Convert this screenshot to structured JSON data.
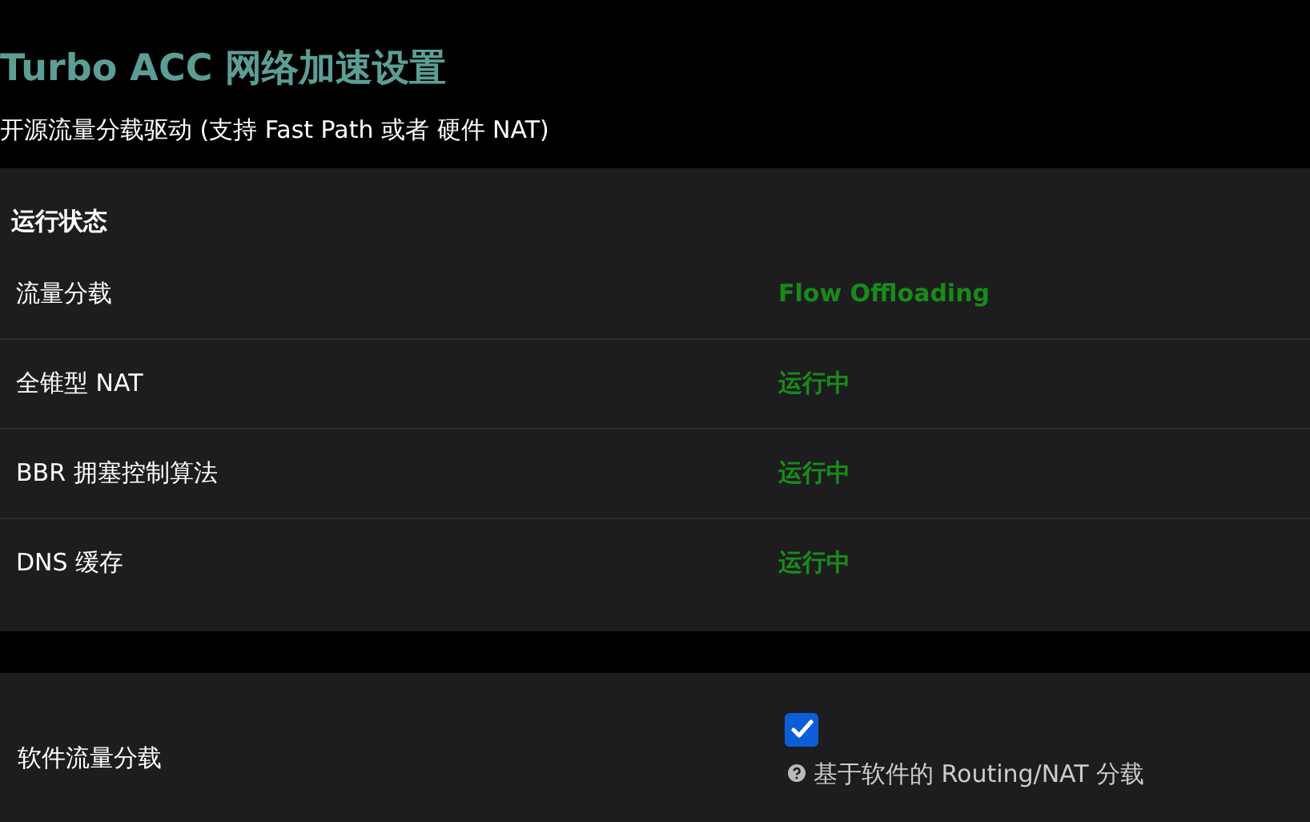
{
  "page": {
    "title": "Turbo ACC 网络加速设置",
    "subtitle": "开源流量分载驱动 (支持 Fast Path 或者 硬件 NAT)"
  },
  "status": {
    "title": "运行状态",
    "rows": [
      {
        "label": "流量分载",
        "value": "Flow Offloading"
      },
      {
        "label": "全锥型 NAT",
        "value": "运行中"
      },
      {
        "label": "BBR 拥塞控制算法",
        "value": "运行中"
      },
      {
        "label": "DNS 缓存",
        "value": "运行中"
      }
    ]
  },
  "settings": [
    {
      "label": "软件流量分载",
      "checked": true,
      "help": "基于软件的 Routing/NAT 分载"
    }
  ]
}
